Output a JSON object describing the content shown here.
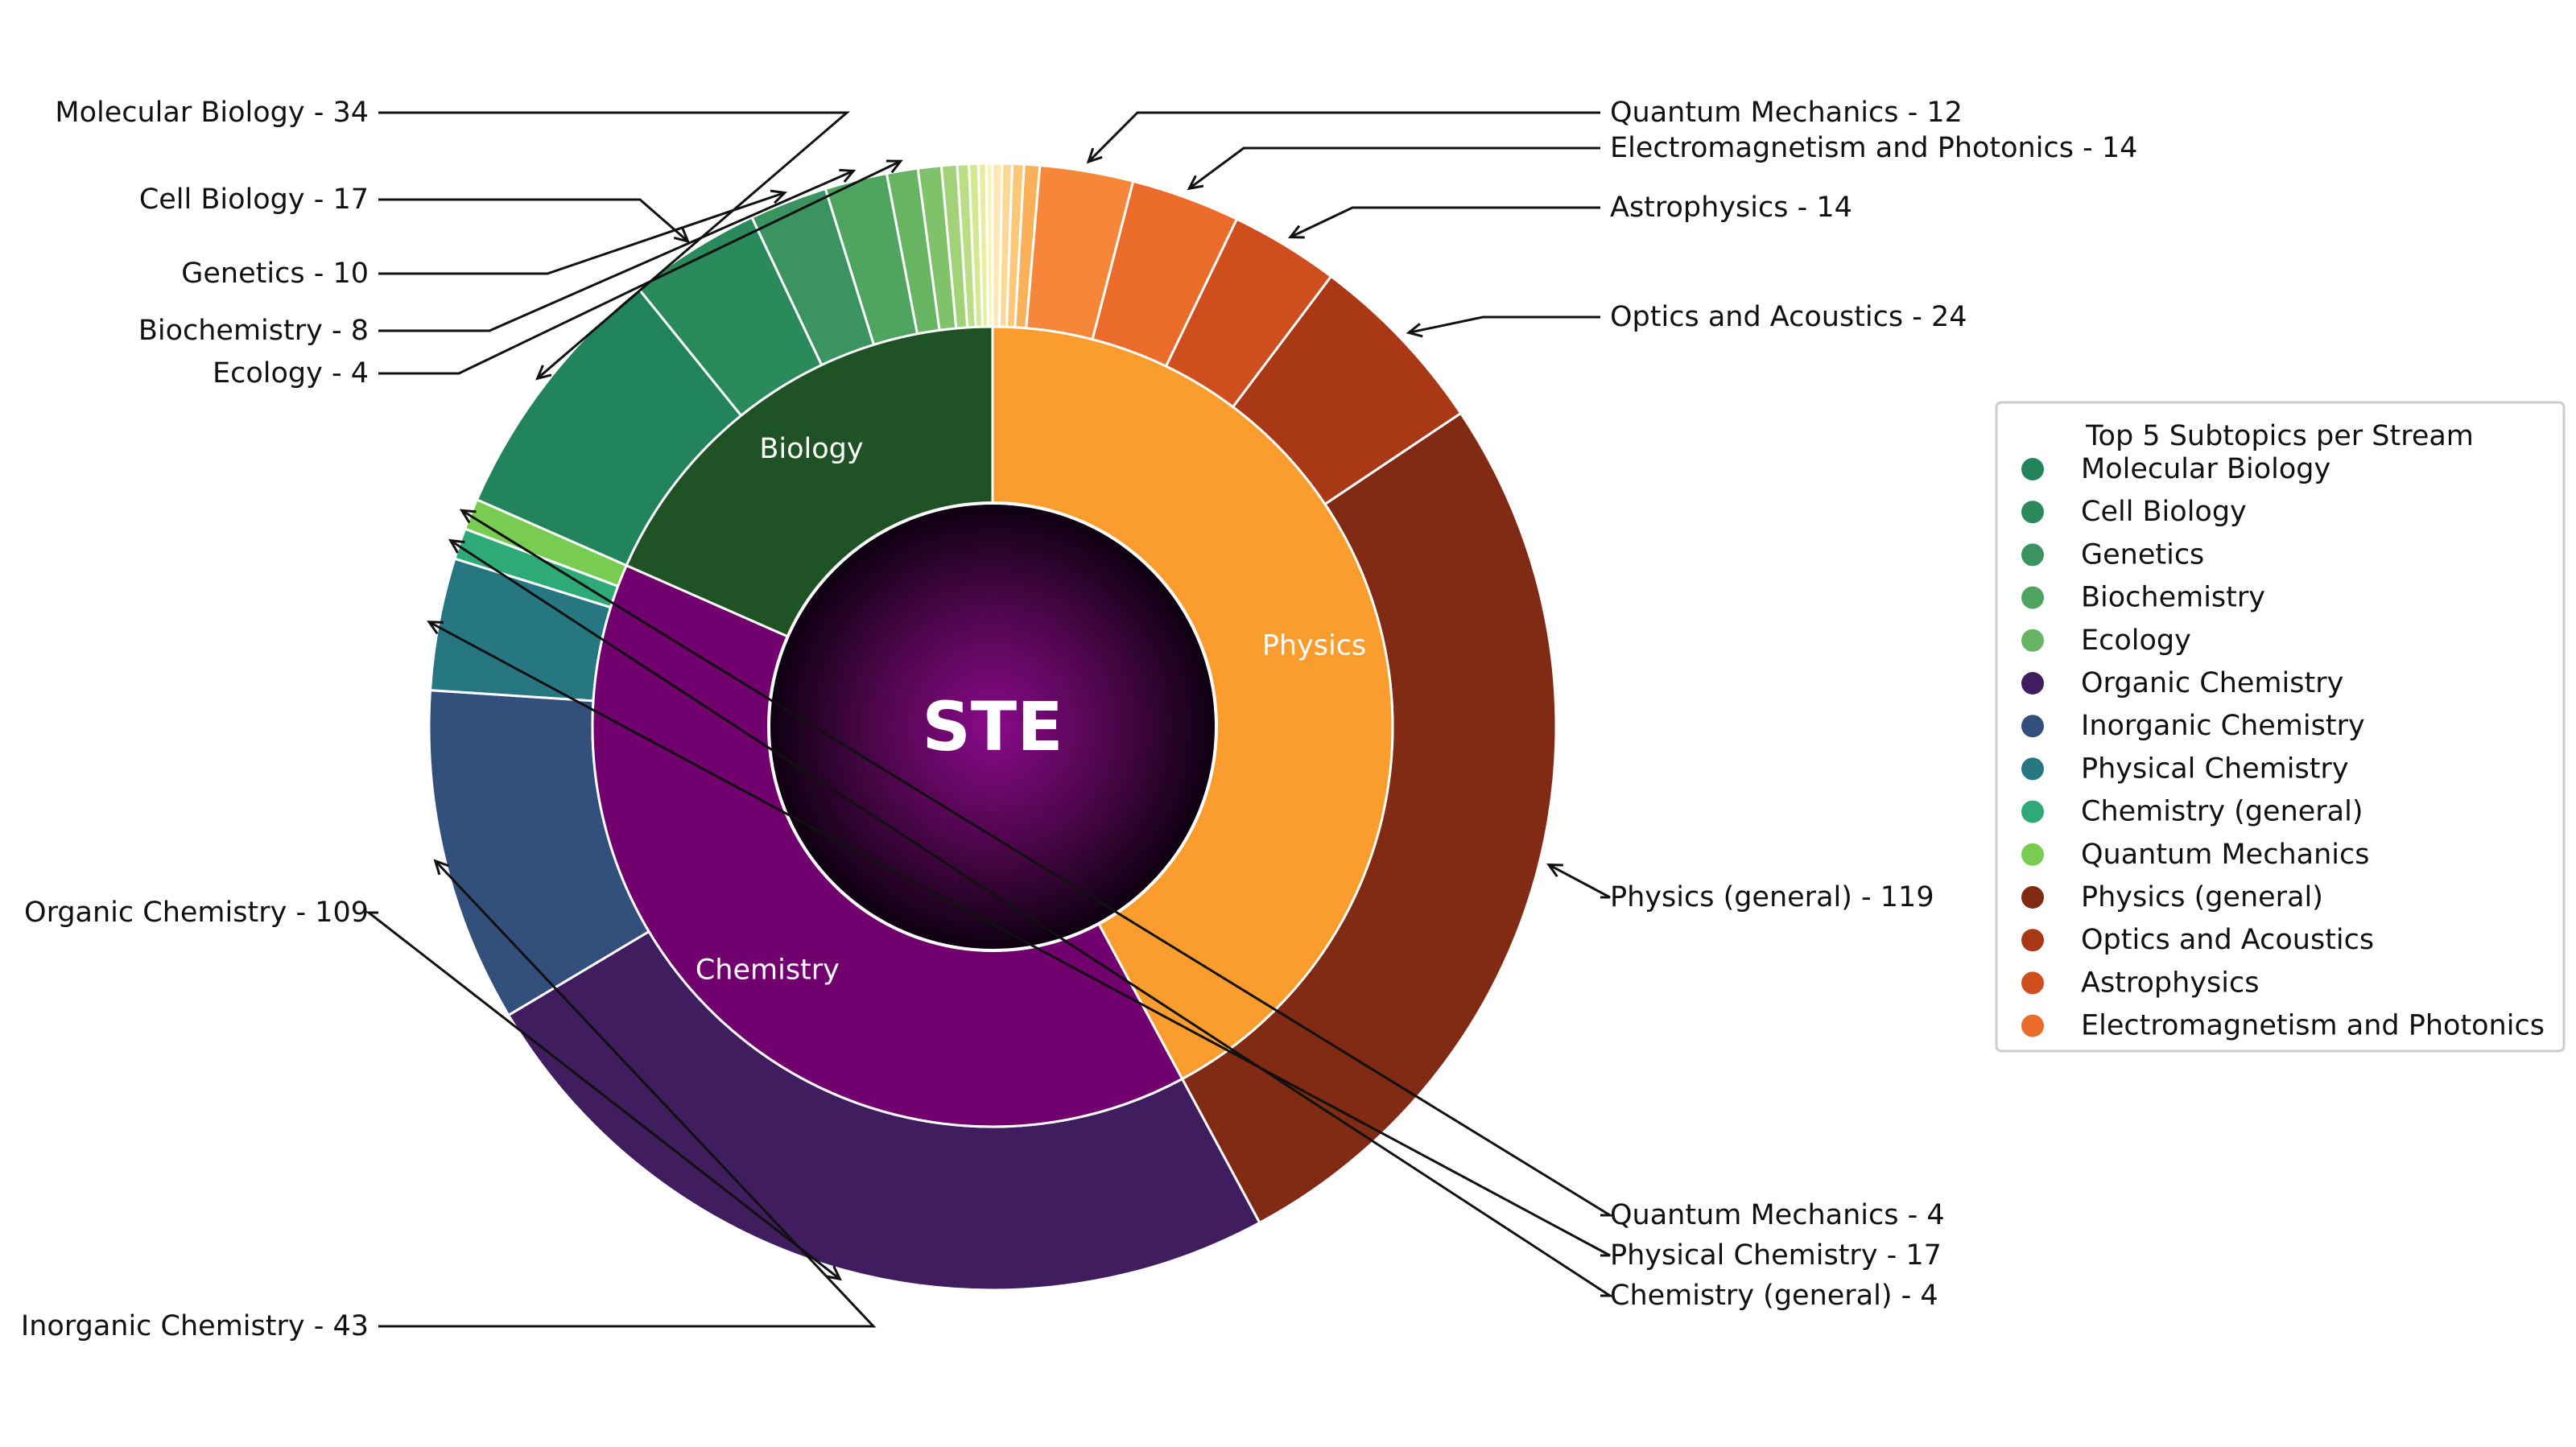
{
  "chart_data": {
    "type": "sunburst",
    "center_label": "STE",
    "streams": [
      {
        "name": "Biology",
        "color": "#1f5224",
        "subtopics": [
          {
            "name": "Molecular Biology",
            "value": 34,
            "color": "#22845c",
            "label": "Molecular Biology - 34"
          },
          {
            "name": "Cell Biology",
            "value": 17,
            "color": "#2b8a5c",
            "label": "Cell Biology - 17"
          },
          {
            "name": "Genetics",
            "value": 10,
            "color": "#3b935f",
            "label": "Genetics - 10"
          },
          {
            "name": "Biochemistry",
            "value": 8,
            "color": "#4fa560",
            "label": "Biochemistry - 8"
          },
          {
            "name": "Ecology",
            "value": 4,
            "color": "#67b463",
            "label": "Ecology - 4"
          },
          {
            "name": "",
            "value": 3,
            "color": "#80c26a",
            "label": ""
          },
          {
            "name": "",
            "value": 2,
            "color": "#a2d277",
            "label": ""
          },
          {
            "name": "",
            "value": 1.5,
            "color": "#bade85",
            "label": ""
          },
          {
            "name": "",
            "value": 1.2,
            "color": "#d3e98e",
            "label": ""
          },
          {
            "name": "",
            "value": 1,
            "color": "#e6ef9d",
            "label": ""
          },
          {
            "name": "",
            "value": 0.8,
            "color": "#f4f5b6",
            "label": ""
          }
        ]
      },
      {
        "name": "Chemistry",
        "color": "#71006e",
        "subtopics": [
          {
            "name": "Organic Chemistry",
            "value": 109,
            "color": "#3f1d5e",
            "label": "Organic Chemistry - 109"
          },
          {
            "name": "Inorganic Chemistry",
            "value": 43,
            "color": "#334f7c",
            "label": "Inorganic Chemistry - 43"
          },
          {
            "name": "Physical Chemistry",
            "value": 17,
            "color": "#267781",
            "label": "Physical Chemistry - 17"
          },
          {
            "name": "Chemistry (general)",
            "value": 4,
            "color": "#2eaa78",
            "label": "Chemistry (general) - 4"
          },
          {
            "name": "Quantum Mechanics",
            "value": 4,
            "color": "#78cc52",
            "label": "Quantum Mechanics - 4"
          }
        ]
      },
      {
        "name": "Physics",
        "color": "#fa9d2e",
        "subtopics": [
          {
            "name": "Physics (general)",
            "value": 119,
            "color": "#812a14",
            "label": "Physics (general) - 119"
          },
          {
            "name": "Optics and Acoustics",
            "value": 24,
            "color": "#a93816",
            "label": "Optics and Acoustics - 24"
          },
          {
            "name": "Astrophysics",
            "value": 14,
            "color": "#ce4e1e",
            "label": "Astrophysics - 14"
          },
          {
            "name": "Electromagnetism and Photonics",
            "value": 14,
            "color": "#ea6b2a",
            "label": "Electromagnetism and Photonics - 14"
          },
          {
            "name": "Quantum Mechanics",
            "value": 12,
            "color": "#f6873a",
            "label": "Quantum Mechanics - 12"
          },
          {
            "name": "",
            "value": 2,
            "color": "#fbb159",
            "label": ""
          },
          {
            "name": "",
            "value": 1.5,
            "color": "#fdc777",
            "label": ""
          },
          {
            "name": "",
            "value": 1.3,
            "color": "#fed897",
            "label": ""
          },
          {
            "name": "",
            "value": 1.2,
            "color": "#fee8b5",
            "label": ""
          }
        ]
      }
    ],
    "legend": {
      "title": "Top 5 Subtopics per Stream",
      "placement": "right",
      "entries": [
        {
          "label": "Molecular Biology",
          "color": "#22845c"
        },
        {
          "label": "Cell Biology",
          "color": "#2b8a5c"
        },
        {
          "label": "Genetics",
          "color": "#3b935f"
        },
        {
          "label": "Biochemistry",
          "color": "#4fa560"
        },
        {
          "label": "Ecology",
          "color": "#67b463"
        },
        {
          "label": "Organic Chemistry",
          "color": "#3f1d5e"
        },
        {
          "label": "Inorganic Chemistry",
          "color": "#334f7c"
        },
        {
          "label": "Physical Chemistry",
          "color": "#267781"
        },
        {
          "label": "Chemistry (general)",
          "color": "#2eaa78"
        },
        {
          "label": "Quantum Mechanics",
          "color": "#78cc52"
        },
        {
          "label": "Physics (general)",
          "color": "#812a14"
        },
        {
          "label": "Optics and Acoustics",
          "color": "#a93816"
        },
        {
          "label": "Astrophysics",
          "color": "#ce4e1e"
        },
        {
          "label": "Electromagnetism and Photonics",
          "color": "#ea6b2a"
        }
      ]
    }
  }
}
